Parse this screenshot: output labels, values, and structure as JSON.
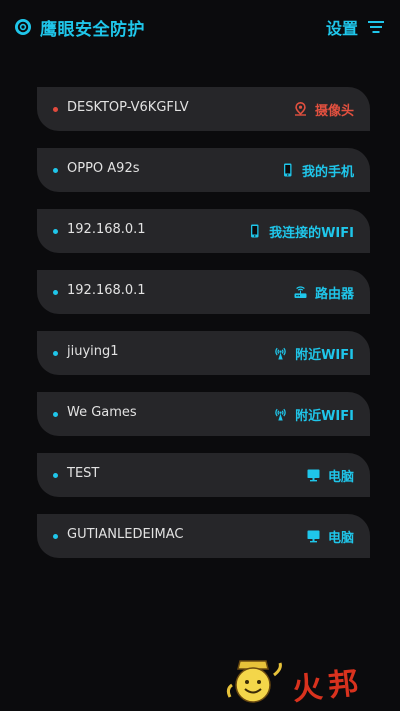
{
  "header": {
    "title": "鹰眼安全防护",
    "settings_label": "设置",
    "accent": "#1fc6ea"
  },
  "devices": [
    {
      "name": "DESKTOP-V6KGFLV",
      "type": "摄像头",
      "icon": "camera-pin-icon",
      "alert": true
    },
    {
      "name": "OPPO A92s",
      "type": "我的手机",
      "icon": "phone-icon",
      "alert": false
    },
    {
      "name": "192.168.0.1",
      "type": "我连接的WIFI",
      "icon": "phone-icon",
      "alert": false
    },
    {
      "name": "192.168.0.1",
      "type": "路由器",
      "icon": "router-icon",
      "alert": false
    },
    {
      "name": "jiuying1",
      "type": "附近WIFI",
      "icon": "wifi-broadcast-icon",
      "alert": false
    },
    {
      "name": "We Games",
      "type": "附近WIFI",
      "icon": "wifi-broadcast-icon",
      "alert": false
    },
    {
      "name": "TEST",
      "type": "电脑",
      "icon": "monitor-icon",
      "alert": false
    },
    {
      "name": "GUTIANLEDEIMAC",
      "type": "电脑",
      "icon": "monitor-icon",
      "alert": false
    }
  ],
  "watermark": {
    "text": "火邦"
  },
  "colors": {
    "alert": "#e2503f",
    "row_bg": "#262629",
    "page_bg": "#0b0b0d"
  }
}
